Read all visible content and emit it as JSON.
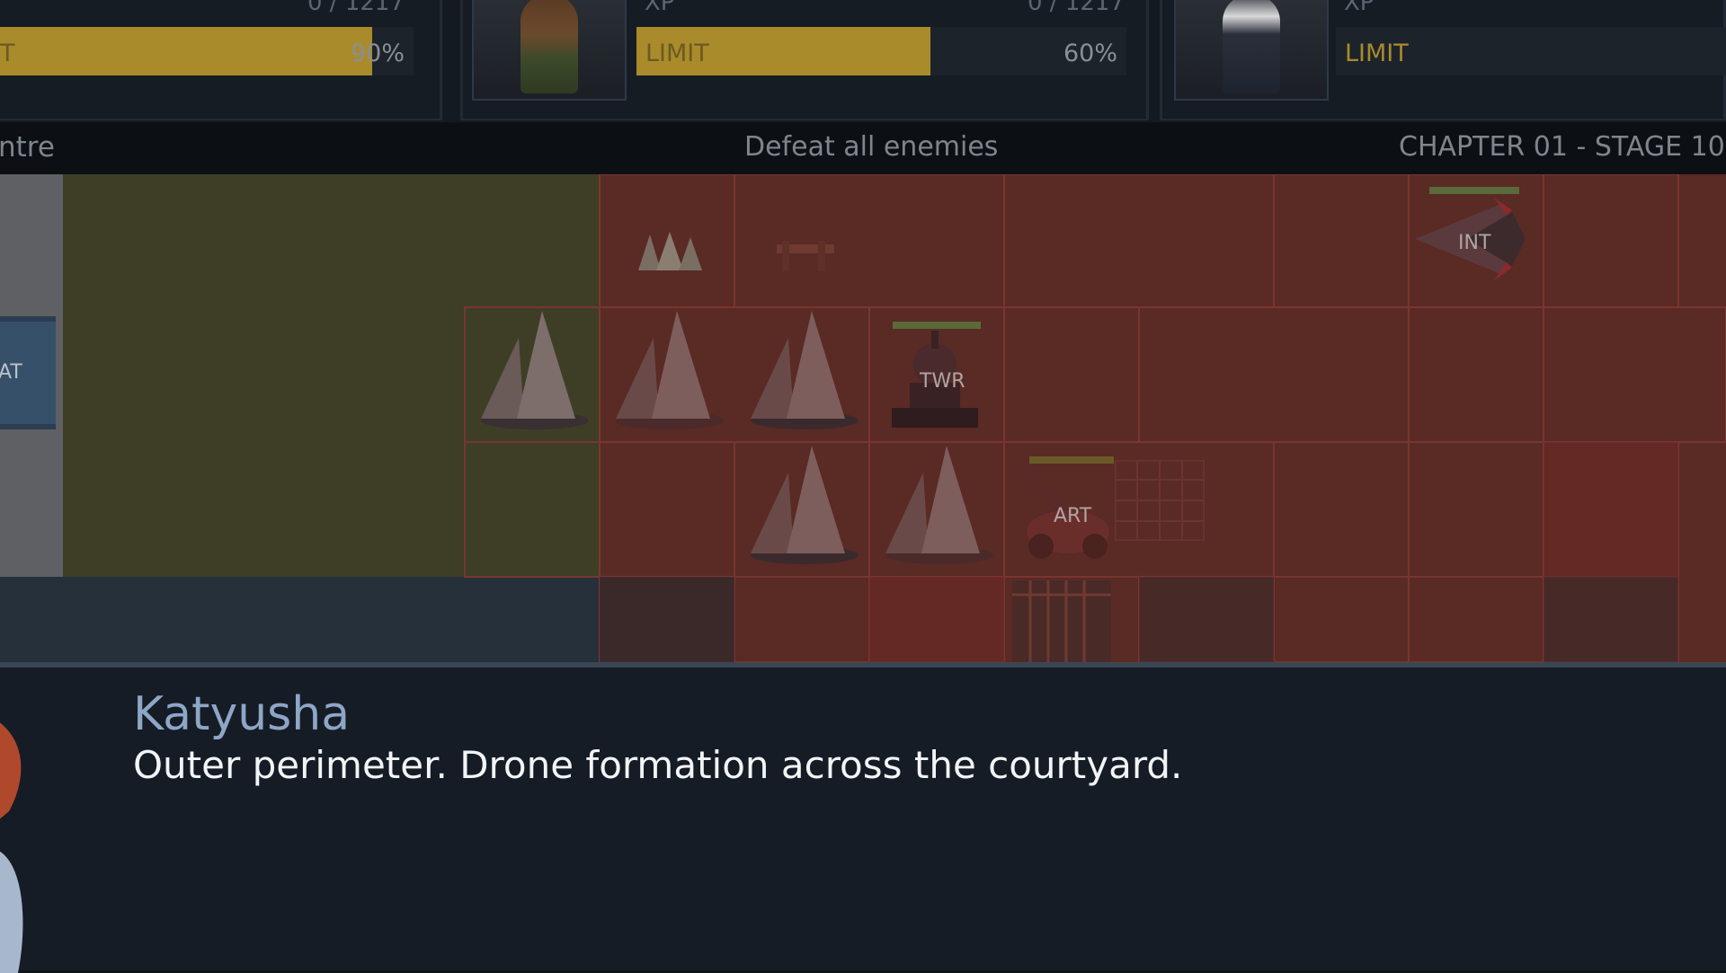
{
  "party": [
    {
      "xp_value": "0 / 1217",
      "limit_label": "T",
      "limit_percent": "90%",
      "fill": 0.9
    },
    {
      "xp_label": "XP",
      "xp_value": "0 / 1217",
      "limit_label": "LIMIT",
      "limit_percent": "60%",
      "fill": 0.6
    },
    {
      "xp_label": "XP",
      "limit_label": "LIMIT"
    }
  ],
  "objective": {
    "location_partial": "ntre",
    "text": "Defeat all enemies",
    "stage": "CHAPTER 01  -  STAGE 10"
  },
  "units": {
    "at": "AT",
    "int": "INT",
    "twr": "TWR",
    "art": "ART"
  },
  "dialogue": {
    "speaker": "Katyusha",
    "line": "Outer perimeter. Drone formation across the courtyard."
  },
  "colors": {
    "limit_fill": "#a98b2c",
    "speaker": "#8ea6c6",
    "danger_zone": "#6a2826"
  },
  "icons": [
    "portrait-icon",
    "spike-trap-icon",
    "barricade-icon",
    "cone-drone-icon",
    "tank-icon",
    "jet-icon",
    "turret-icon",
    "artillery-icon"
  ]
}
